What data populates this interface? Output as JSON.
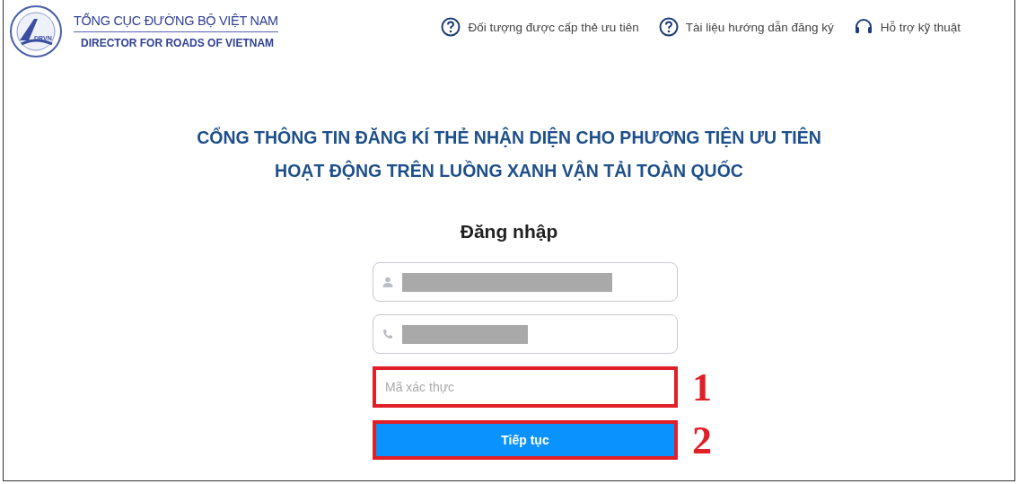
{
  "header": {
    "logo_mark": "DRVN",
    "org_name": "TỔNG CỤC ĐƯỜNG BỘ VIỆT NAM",
    "org_name_en": "DIRECTOR FOR ROADS OF VIETNAM",
    "links": [
      {
        "kind": "help",
        "label": "Đối tượng được cấp thẻ ưu tiên"
      },
      {
        "kind": "help",
        "label": "Tài liệu hướng dẫn đăng ký"
      },
      {
        "kind": "support",
        "label": "Hỗ trợ kỹ thuật"
      }
    ]
  },
  "title_lines": [
    "CỔNG THÔNG TIN ĐĂNG KÍ THẺ NHẬN DIỆN CHO PHƯƠNG TIỆN ƯU TIÊN",
    "HOẠT ĐỘNG TRÊN LUỒNG XANH VẬN TẢI TOÀN QUỐC"
  ],
  "form": {
    "heading": "Đăng nhập",
    "fields": [
      {
        "kind": "user",
        "redacted": true,
        "highlighted": false
      },
      {
        "kind": "phone",
        "redacted": true,
        "highlighted": false
      },
      {
        "kind": "code",
        "placeholder": "Mã xác thực",
        "redacted": false,
        "highlighted": true,
        "annotation": "1"
      }
    ],
    "submit": {
      "label": "Tiếp tục",
      "highlighted": true,
      "annotation": "2"
    }
  }
}
